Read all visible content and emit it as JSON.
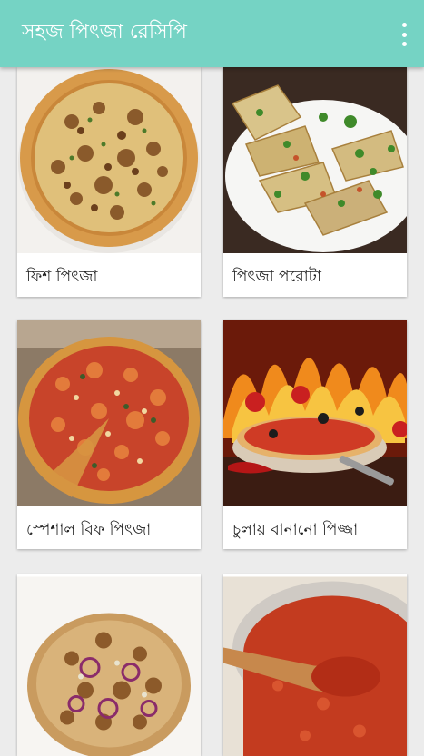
{
  "app": {
    "title": "সহজ পিৎজা রেসিপি",
    "accent_color": "#75d3c4",
    "menu_icon": "more-vert-icon"
  },
  "recipes": [
    {
      "label": "ফিশ পিৎজা",
      "image": "fish-pizza-photo"
    },
    {
      "label": "পিৎজা পরোটা",
      "image": "pizza-paratha-photo"
    },
    {
      "label": "স্পেশাল বিফ পিৎজা",
      "image": "beef-pizza-photo"
    },
    {
      "label": "চুলায় বানানো পিজ্জা",
      "image": "stove-pizza-photo"
    },
    {
      "label": "",
      "image": "chicken-pizza-photo"
    },
    {
      "label": "",
      "image": "pizza-sauce-photo"
    }
  ]
}
